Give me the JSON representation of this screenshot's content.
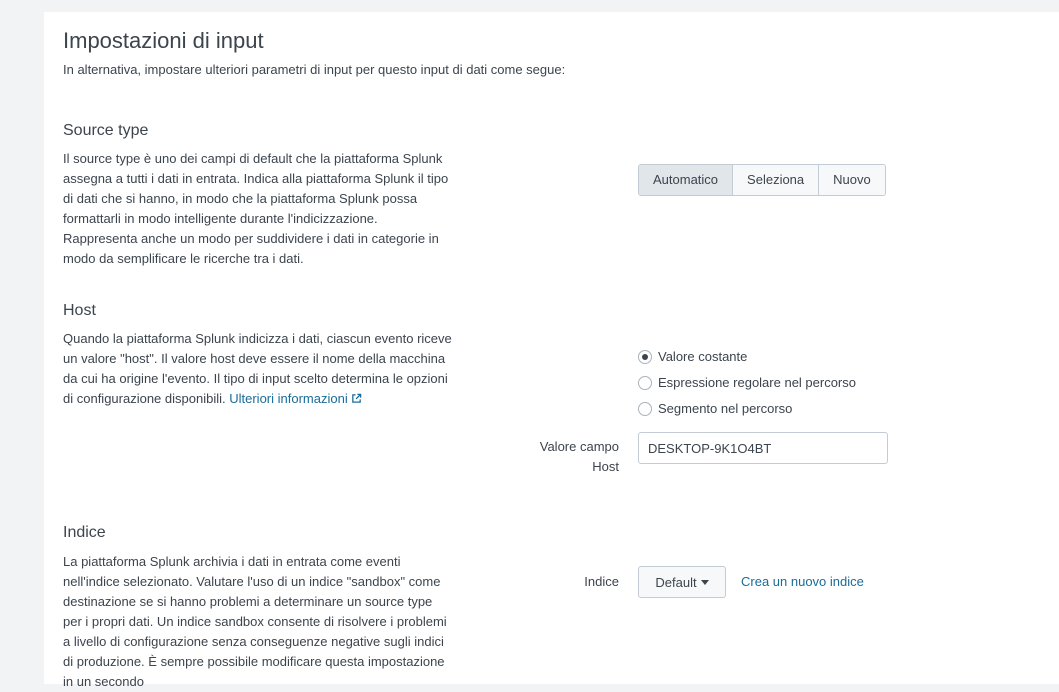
{
  "header": {
    "title": "Impostazioni di input",
    "subtitle": "In alternativa, impostare ulteriori parametri di input per questo input di dati come segue:"
  },
  "source_type": {
    "title": "Source type",
    "description": "Il source type è uno dei campi di default che la piattaforma Splunk assegna a tutti i dati in entrata. Indica alla piattaforma Splunk il tipo di dati che si hanno, in modo che la piattaforma Splunk possa formattarli in modo intelligente durante l'indicizzazione. Rappresenta anche un modo per suddividere i dati in categorie in modo da semplificare le ricerche tra i dati.",
    "options": [
      "Automatico",
      "Seleziona",
      "Nuovo"
    ],
    "selected": "Automatico"
  },
  "host": {
    "title": "Host",
    "description": "Quando la piattaforma Splunk indicizza i dati, ciascun evento riceve un valore \"host\". Il valore host deve essere il nome della macchina da cui ha origine l'evento. Il tipo di input scelto determina le opzioni di configurazione disponibili.",
    "more_link": "Ulteriori informazioni",
    "radio_options": [
      {
        "label": "Valore costante",
        "checked": true
      },
      {
        "label": "Espressione regolare nel percorso",
        "checked": false
      },
      {
        "label": "Segmento nel percorso",
        "checked": false
      }
    ],
    "field_label": "Valore campo Host",
    "field_value": "DESKTOP-9K1O4BT"
  },
  "index": {
    "title": "Indice",
    "description": "La piattaforma Splunk archivia i dati in entrata come eventi nell'indice selezionato. Valutare l'uso di un indice \"sandbox\" come destinazione se si hanno problemi a determinare un source type per i propri dati. Un indice sandbox consente di risolvere i problemi a livello di configurazione senza conseguenze negative sugli indici di produzione. È sempre possibile modificare questa impostazione in un secondo",
    "field_label": "Indice",
    "dropdown_value": "Default",
    "new_index_link": "Crea un nuovo indice"
  },
  "colors": {
    "background": "#f2f3f4",
    "text": "#3c444d",
    "link": "#1a6c99",
    "selected_segment": "#e1e6eb"
  }
}
